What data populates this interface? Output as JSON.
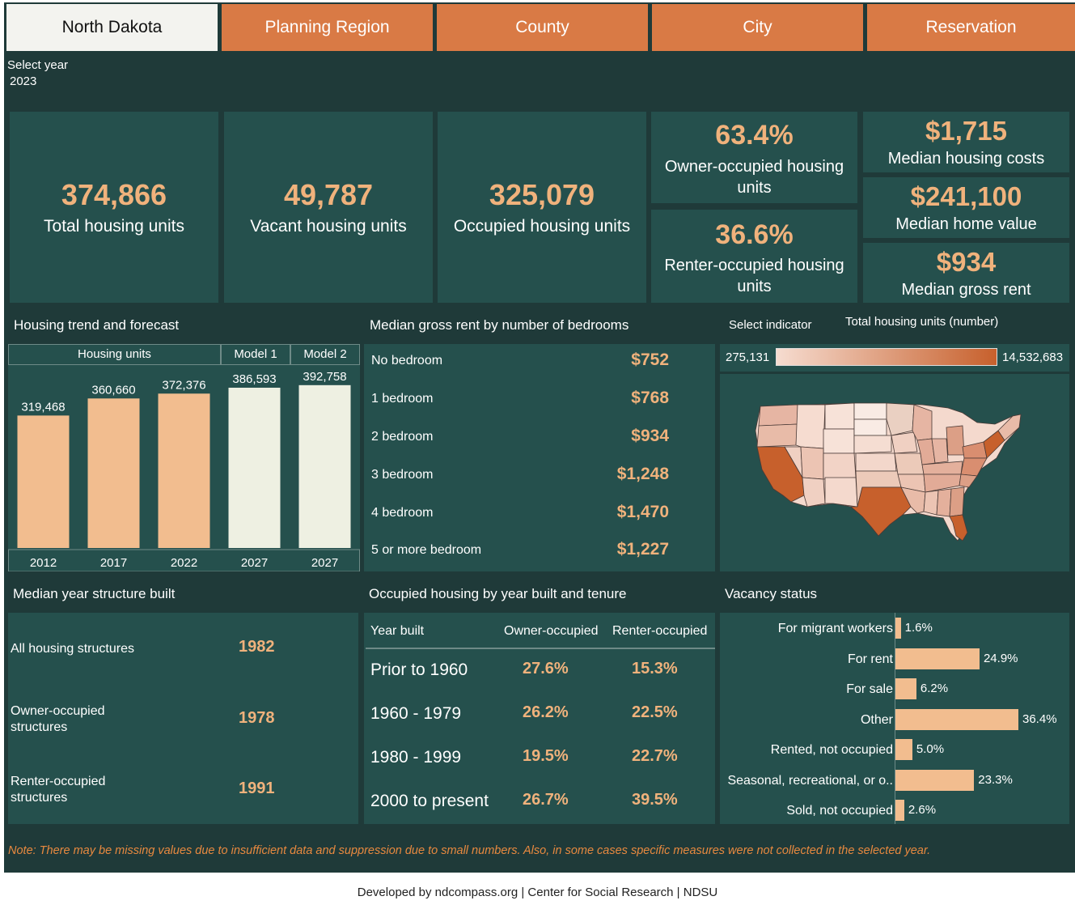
{
  "tabs": [
    "North Dakota",
    "Planning Region",
    "County",
    "City",
    "Reservation"
  ],
  "year_filter": {
    "label": "Select year",
    "value": "2023"
  },
  "kpis": {
    "total": {
      "value": "374,866",
      "label": "Total housing units"
    },
    "vacant": {
      "value": "49,787",
      "label": "Vacant housing units"
    },
    "occupied": {
      "value": "325,079",
      "label": "Occupied housing units"
    },
    "owner_pct": {
      "value": "63.4%",
      "label": "Owner-occupied housing units"
    },
    "renter_pct": {
      "value": "36.6%",
      "label": "Renter-occupied housing units"
    },
    "median_costs": {
      "value": "$1,715",
      "label": "Median housing costs"
    },
    "median_home_value": {
      "value": "$241,100",
      "label": "Median home value"
    },
    "median_gross_rent": {
      "value": "$934",
      "label": "Median gross rent"
    }
  },
  "trend": {
    "title": "Housing trend and forecast",
    "headers": [
      "Housing units",
      "Model 1",
      "Model 2"
    ]
  },
  "chart_data": {
    "type": "bar",
    "categories": [
      "2012",
      "2017",
      "2022",
      "2027",
      "2027"
    ],
    "values": [
      319468,
      360660,
      372376,
      386593,
      392758
    ],
    "value_labels": [
      "319,468",
      "360,660",
      "372,376",
      "386,593",
      "392,758"
    ],
    "ylim": [
      0,
      410000
    ],
    "colors": [
      "#f2bd8f",
      "#f2bd8f",
      "#f2bd8f",
      "#eef0e2",
      "#eef0e2"
    ]
  },
  "rent_by_bedrooms": {
    "title": "Median gross rent by number of bedrooms",
    "rows": [
      {
        "label": "No bedroom",
        "value": "$752"
      },
      {
        "label": "1 bedroom",
        "value": "$768"
      },
      {
        "label": "2 bedroom",
        "value": "$934"
      },
      {
        "label": "3 bedroom",
        "value": "$1,248"
      },
      {
        "label": "4 bedroom",
        "value": "$1,470"
      },
      {
        "label": "5 or more bedroom",
        "value": "$1,227"
      }
    ]
  },
  "map": {
    "indicator_label": "Select indicator",
    "indicator_value": "Total housing units (number)",
    "scale_min": "275,131",
    "scale_max": "14,532,683",
    "colors": {
      "low": "#f6dcd0",
      "high": "#c7602c"
    }
  },
  "median_year": {
    "title": "Median year structure built",
    "rows": [
      {
        "label": "All housing structures",
        "value": "1982"
      },
      {
        "label": "Owner-occupied structures",
        "value": "1978"
      },
      {
        "label": "Renter-occupied structures",
        "value": "1991"
      }
    ]
  },
  "year_built": {
    "title": "Occupied housing by year built and tenure",
    "headers": [
      "Year built",
      "Owner-occupied",
      "Renter-occupied"
    ],
    "rows": [
      {
        "year": "Prior to 1960",
        "owner": "27.6%",
        "renter": "15.3%"
      },
      {
        "year": "1960 - 1979",
        "owner": "26.2%",
        "renter": "22.5%"
      },
      {
        "year": "1980 - 1999",
        "owner": "19.5%",
        "renter": "22.7%"
      },
      {
        "year": "2000 to present",
        "owner": "26.7%",
        "renter": "39.5%"
      }
    ]
  },
  "vacancy": {
    "title": "Vacancy status",
    "rows": [
      {
        "label": "For migrant workers",
        "value": 1.6,
        "text": "1.6%"
      },
      {
        "label": "For rent",
        "value": 24.9,
        "text": "24.9%"
      },
      {
        "label": "For sale",
        "value": 6.2,
        "text": "6.2%"
      },
      {
        "label": "Other",
        "value": 36.4,
        "text": "36.4%"
      },
      {
        "label": "Rented, not occupied",
        "value": 5.0,
        "text": "5.0%"
      },
      {
        "label": "Seasonal, recreational, or o..",
        "value": 23.3,
        "text": "23.3%"
      },
      {
        "label": "Sold, not occupied",
        "value": 2.6,
        "text": "2.6%"
      }
    ]
  },
  "note": "Note: There may be missing values due to insufficient data and suppression due to small numbers. Also, in some cases specific measures were not collected in the selected year.",
  "footer": "Developed by ndcompass.org | Center for Social Research | NDSU"
}
